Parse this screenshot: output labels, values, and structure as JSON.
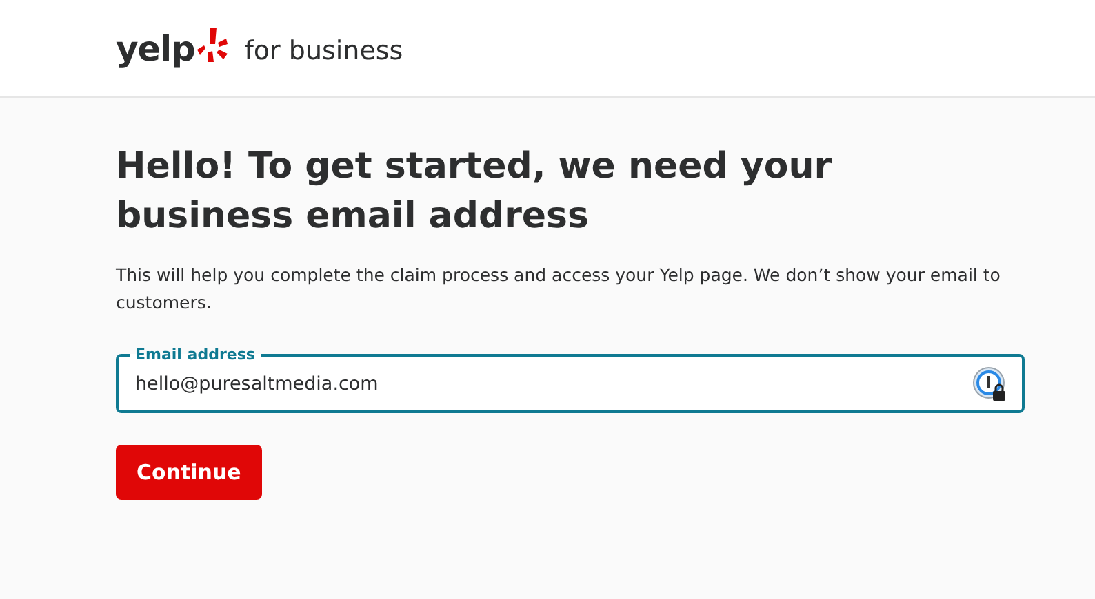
{
  "header": {
    "logo_text": "yelp",
    "product": "for business"
  },
  "heading": "Hello! To get started, we need your business email address",
  "description": "This will help you complete the claim process and access your Yelp page. We don’t show your email to customers.",
  "email_field": {
    "label": "Email address",
    "value": "hello@puresaltmedia.com"
  },
  "button": "Continue"
}
